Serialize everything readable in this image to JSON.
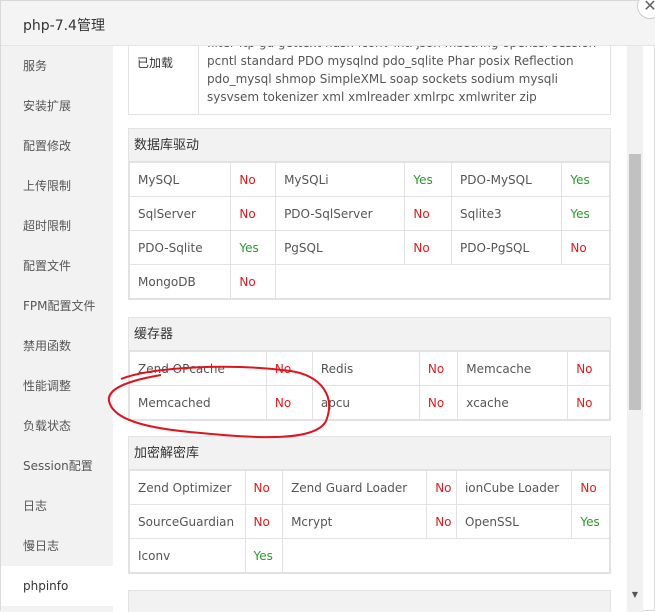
{
  "window": {
    "title": "php-7.4管理",
    "close_symbol": "✕"
  },
  "sidebar": {
    "items": [
      {
        "label": "服务"
      },
      {
        "label": "安装扩展"
      },
      {
        "label": "配置修改"
      },
      {
        "label": "上传限制"
      },
      {
        "label": "超时限制"
      },
      {
        "label": "配置文件"
      },
      {
        "label": "FPM配置文件"
      },
      {
        "label": "禁用函数"
      },
      {
        "label": "性能调整"
      },
      {
        "label": "负载状态"
      },
      {
        "label": "Session配置"
      },
      {
        "label": "日志"
      },
      {
        "label": "慢日志"
      },
      {
        "label": "phpinfo"
      }
    ]
  },
  "loaded": {
    "label": "已加载",
    "text": "filter ftp gd gettext hash iconv intl json mbstring openssl session pcntl standard PDO mysqlnd pdo_sqlite Phar posix Reflection pdo_mysql shmop SimpleXML soap sockets sodium mysqli sysvsem tokenizer xml xmlreader xmlrpc xmlwriter zip"
  },
  "db": {
    "title": "数据库驱动",
    "rows": [
      [
        {
          "name": "MySQL",
          "status": "No"
        },
        {
          "name": "MySQLi",
          "status": "Yes"
        },
        {
          "name": "PDO-MySQL",
          "status": "Yes"
        }
      ],
      [
        {
          "name": "SqlServer",
          "status": "No"
        },
        {
          "name": "PDO-SqlServer",
          "status": "No"
        },
        {
          "name": "Sqlite3",
          "status": "Yes"
        }
      ],
      [
        {
          "name": "PDO-Sqlite",
          "status": "Yes"
        },
        {
          "name": "PgSQL",
          "status": "No"
        },
        {
          "name": "PDO-PgSQL",
          "status": "No"
        }
      ],
      [
        {
          "name": "MongoDB",
          "status": "No"
        }
      ]
    ]
  },
  "cache": {
    "title": "缓存器",
    "rows": [
      [
        {
          "name": "Zend OPcache",
          "status": "No"
        },
        {
          "name": "Redis",
          "status": "No"
        },
        {
          "name": "Memcache",
          "status": "No"
        }
      ],
      [
        {
          "name": "Memcached",
          "status": "No"
        },
        {
          "name": "apcu",
          "status": "No"
        },
        {
          "name": "xcache",
          "status": "No"
        }
      ]
    ]
  },
  "crypto": {
    "title": "加密解密库",
    "rows": [
      [
        {
          "name": "Zend Optimizer",
          "status": "No"
        },
        {
          "name": "Zend Guard Loader",
          "status": "No"
        },
        {
          "name": "ionCube Loader",
          "status": "No"
        }
      ],
      [
        {
          "name": "SourceGuardian",
          "status": "No"
        },
        {
          "name": "Mcrypt",
          "status": "No"
        },
        {
          "name": "OpenSSL",
          "status": "Yes"
        }
      ],
      [
        {
          "name": "Iconv",
          "status": "Yes"
        }
      ]
    ]
  },
  "colors": {
    "no": "#e21a1a",
    "yes": "#2a9a2a",
    "annotation": "#e0141e"
  }
}
